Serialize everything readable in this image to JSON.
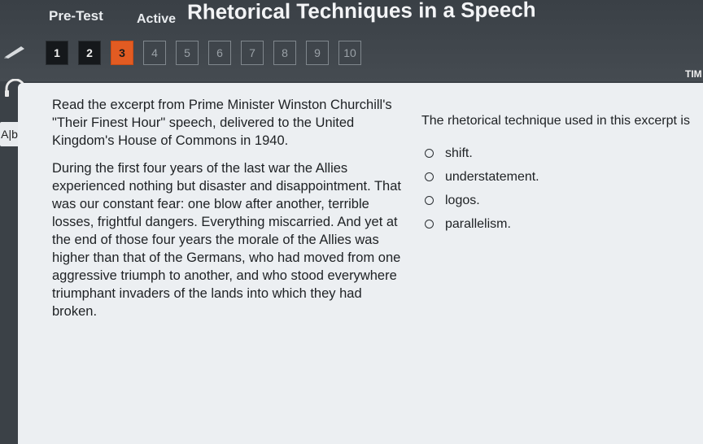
{
  "header": {
    "pretest_label": "Pre-Test",
    "active_label": "Active",
    "title": "Rhetorical Techniques in a Speech",
    "timer_label": "TIM"
  },
  "question_nav": [
    {
      "label": "1",
      "state": "done"
    },
    {
      "label": "2",
      "state": "done"
    },
    {
      "label": "3",
      "state": "current"
    },
    {
      "label": "4",
      "state": "todo"
    },
    {
      "label": "5",
      "state": "todo"
    },
    {
      "label": "6",
      "state": "todo"
    },
    {
      "label": "7",
      "state": "todo"
    },
    {
      "label": "8",
      "state": "todo"
    },
    {
      "label": "9",
      "state": "todo"
    },
    {
      "label": "10",
      "state": "todo"
    }
  ],
  "tools": {
    "abc_label": "A|bc",
    "icons": [
      "pencil-icon",
      "headphones-icon",
      "abc-icon"
    ]
  },
  "passage": {
    "intro": "Read the excerpt from Prime Minister Winston Churchill's \"Their Finest Hour\" speech, delivered to the United Kingdom's House of Commons in 1940.",
    "excerpt": "During the first four years of the last war the Allies experienced nothing but disaster and disappointment. That was our constant fear: one blow after another, terrible losses, frightful dangers. Everything miscarried. And yet at the end of those four years the morale of the Allies was higher than that of the Germans, who had moved from one aggressive triumph to another, and who stood everywhere triumphant invaders of the lands into which they had broken."
  },
  "question": {
    "prompt": "The rhetorical technique used in this excerpt is",
    "options": [
      "shift.",
      "understatement.",
      "logos.",
      "parallelism."
    ]
  },
  "colors": {
    "current_question": "#e25b22",
    "header_bg": "#3b4147",
    "content_bg": "#eceff2"
  }
}
